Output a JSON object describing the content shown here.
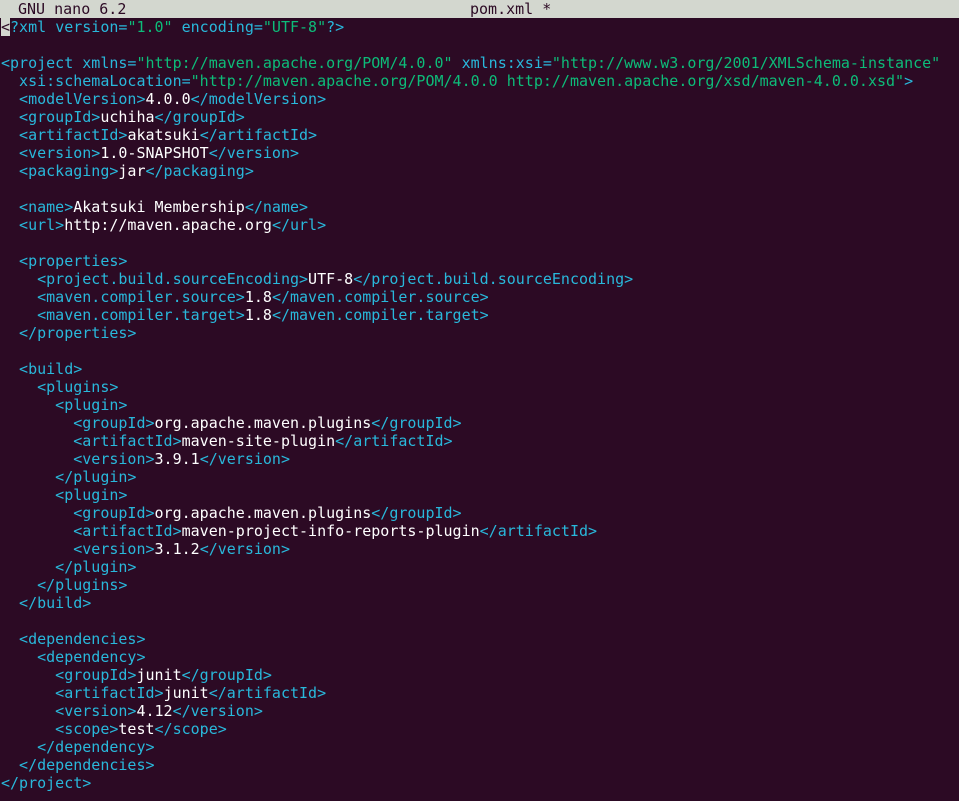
{
  "titlebar": {
    "app_name": "GNU nano 6.2",
    "file_name": "pom.xml *"
  },
  "colors": {
    "background": "#2c0a24",
    "titlebar": "#d3d7cf",
    "tag": "#29b8db",
    "value": "#0dbc79",
    "text": "#ffffff"
  },
  "editor": {
    "lines": [
      [
        {
          "c": "cursor",
          "t": "<"
        },
        {
          "c": "tag",
          "t": "?xml "
        },
        {
          "c": "attr",
          "t": "version="
        },
        {
          "c": "val",
          "t": "\"1.0\""
        },
        {
          "c": "attr",
          "t": " encoding="
        },
        {
          "c": "val",
          "t": "\"UTF-8\""
        },
        {
          "c": "tag",
          "t": "?>"
        }
      ],
      [],
      [
        {
          "c": "tag",
          "t": "<project "
        },
        {
          "c": "attr",
          "t": "xmlns="
        },
        {
          "c": "val",
          "t": "\"http://maven.apache.org/POM/4.0.0\""
        },
        {
          "c": "attr",
          "t": " xmlns:xsi="
        },
        {
          "c": "val",
          "t": "\"http://www.w3.org/2001/XMLSchema-instance\""
        }
      ],
      [
        {
          "c": "attr",
          "t": "  xsi:schemaLocation="
        },
        {
          "c": "val",
          "t": "\"http://maven.apache.org/POM/4.0.0 http://maven.apache.org/xsd/maven-4.0.0.xsd\""
        },
        {
          "c": "tag",
          "t": ">"
        }
      ],
      [
        {
          "c": "tag",
          "t": "  <modelVersion>"
        },
        {
          "c": "txt",
          "t": "4.0.0"
        },
        {
          "c": "tag",
          "t": "</modelVersion>"
        }
      ],
      [
        {
          "c": "tag",
          "t": "  <groupId>"
        },
        {
          "c": "txt",
          "t": "uchiha"
        },
        {
          "c": "tag",
          "t": "</groupId>"
        }
      ],
      [
        {
          "c": "tag",
          "t": "  <artifactId>"
        },
        {
          "c": "txt",
          "t": "akatsuki"
        },
        {
          "c": "tag",
          "t": "</artifactId>"
        }
      ],
      [
        {
          "c": "tag",
          "t": "  <version>"
        },
        {
          "c": "txt",
          "t": "1.0-SNAPSHOT"
        },
        {
          "c": "tag",
          "t": "</version>"
        }
      ],
      [
        {
          "c": "tag",
          "t": "  <packaging>"
        },
        {
          "c": "txt",
          "t": "jar"
        },
        {
          "c": "tag",
          "t": "</packaging>"
        }
      ],
      [],
      [
        {
          "c": "tag",
          "t": "  <name>"
        },
        {
          "c": "txt",
          "t": "Akatsuki Membership"
        },
        {
          "c": "tag",
          "t": "</name>"
        }
      ],
      [
        {
          "c": "tag",
          "t": "  <url>"
        },
        {
          "c": "txt",
          "t": "http://maven.apache.org"
        },
        {
          "c": "tag",
          "t": "</url>"
        }
      ],
      [],
      [
        {
          "c": "tag",
          "t": "  <properties>"
        }
      ],
      [
        {
          "c": "tag",
          "t": "    <project.build.sourceEncoding>"
        },
        {
          "c": "txt",
          "t": "UTF-8"
        },
        {
          "c": "tag",
          "t": "</project.build.sourceEncoding>"
        }
      ],
      [
        {
          "c": "tag",
          "t": "    <maven.compiler.source>"
        },
        {
          "c": "txt",
          "t": "1.8"
        },
        {
          "c": "tag",
          "t": "</maven.compiler.source>"
        }
      ],
      [
        {
          "c": "tag",
          "t": "    <maven.compiler.target>"
        },
        {
          "c": "txt",
          "t": "1.8"
        },
        {
          "c": "tag",
          "t": "</maven.compiler.target>"
        }
      ],
      [
        {
          "c": "tag",
          "t": "  </properties>"
        }
      ],
      [],
      [
        {
          "c": "tag",
          "t": "  <build>"
        }
      ],
      [
        {
          "c": "tag",
          "t": "    <plugins>"
        }
      ],
      [
        {
          "c": "tag",
          "t": "      <plugin>"
        }
      ],
      [
        {
          "c": "tag",
          "t": "        <groupId>"
        },
        {
          "c": "txt",
          "t": "org.apache.maven.plugins"
        },
        {
          "c": "tag",
          "t": "</groupId>"
        }
      ],
      [
        {
          "c": "tag",
          "t": "        <artifactId>"
        },
        {
          "c": "txt",
          "t": "maven-site-plugin"
        },
        {
          "c": "tag",
          "t": "</artifactId>"
        }
      ],
      [
        {
          "c": "tag",
          "t": "        <version>"
        },
        {
          "c": "txt",
          "t": "3.9.1"
        },
        {
          "c": "tag",
          "t": "</version>"
        }
      ],
      [
        {
          "c": "tag",
          "t": "      </plugin>"
        }
      ],
      [
        {
          "c": "tag",
          "t": "      <plugin>"
        }
      ],
      [
        {
          "c": "tag",
          "t": "        <groupId>"
        },
        {
          "c": "txt",
          "t": "org.apache.maven.plugins"
        },
        {
          "c": "tag",
          "t": "</groupId>"
        }
      ],
      [
        {
          "c": "tag",
          "t": "        <artifactId>"
        },
        {
          "c": "txt",
          "t": "maven-project-info-reports-plugin"
        },
        {
          "c": "tag",
          "t": "</artifactId>"
        }
      ],
      [
        {
          "c": "tag",
          "t": "        <version>"
        },
        {
          "c": "txt",
          "t": "3.1.2"
        },
        {
          "c": "tag",
          "t": "</version>"
        }
      ],
      [
        {
          "c": "tag",
          "t": "      </plugin>"
        }
      ],
      [
        {
          "c": "tag",
          "t": "    </plugins>"
        }
      ],
      [
        {
          "c": "tag",
          "t": "  </build>"
        }
      ],
      [],
      [
        {
          "c": "tag",
          "t": "  <dependencies>"
        }
      ],
      [
        {
          "c": "tag",
          "t": "    <dependency>"
        }
      ],
      [
        {
          "c": "tag",
          "t": "      <groupId>"
        },
        {
          "c": "txt",
          "t": "junit"
        },
        {
          "c": "tag",
          "t": "</groupId>"
        }
      ],
      [
        {
          "c": "tag",
          "t": "      <artifactId>"
        },
        {
          "c": "txt",
          "t": "junit"
        },
        {
          "c": "tag",
          "t": "</artifactId>"
        }
      ],
      [
        {
          "c": "tag",
          "t": "      <version>"
        },
        {
          "c": "txt",
          "t": "4.12"
        },
        {
          "c": "tag",
          "t": "</version>"
        }
      ],
      [
        {
          "c": "tag",
          "t": "      <scope>"
        },
        {
          "c": "txt",
          "t": "test"
        },
        {
          "c": "tag",
          "t": "</scope>"
        }
      ],
      [
        {
          "c": "tag",
          "t": "    </dependency>"
        }
      ],
      [
        {
          "c": "tag",
          "t": "  </dependencies>"
        }
      ],
      [
        {
          "c": "tag",
          "t": "</project>"
        }
      ]
    ]
  }
}
